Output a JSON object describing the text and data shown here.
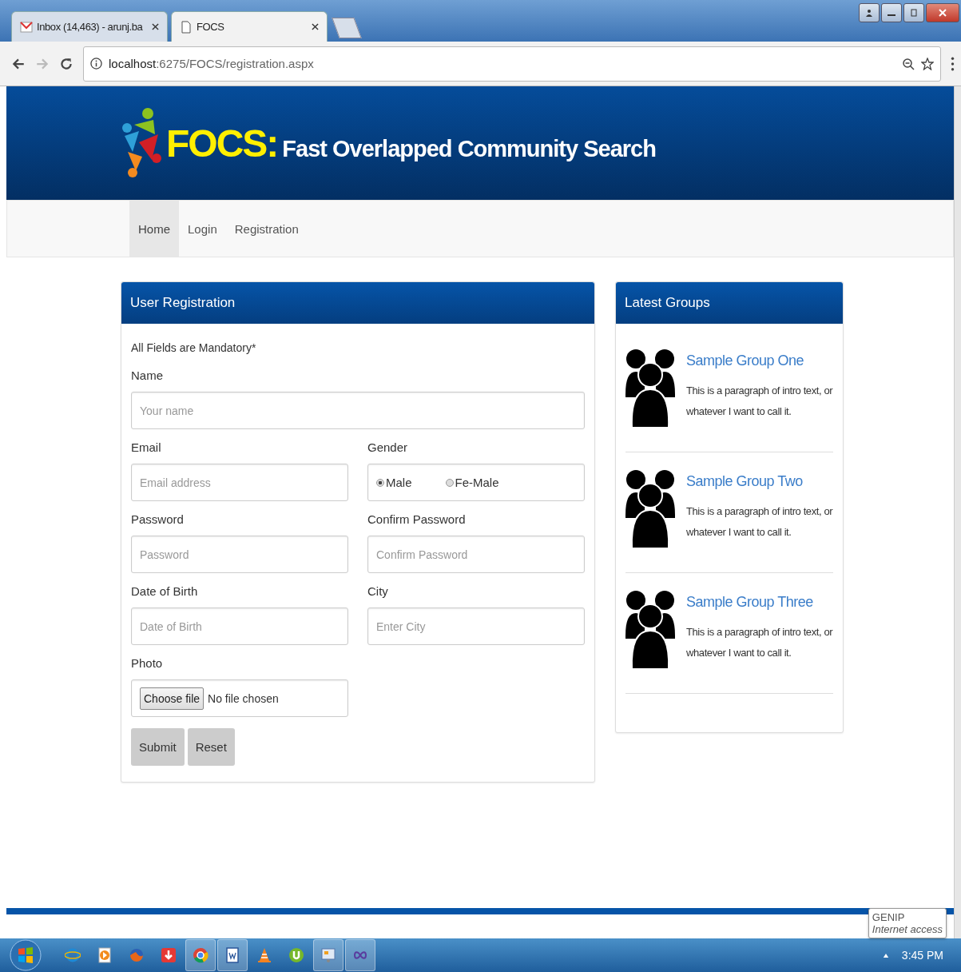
{
  "browser": {
    "tabs": [
      {
        "title": "Inbox (14,463) - arunj.ba",
        "selected": false
      },
      {
        "title": "FOCS",
        "selected": true
      }
    ],
    "url_host": "localhost",
    "url_path": ":6275/FOCS/registration.aspx"
  },
  "header": {
    "brand": "FOCS:",
    "tagline": "Fast Overlapped Community Search"
  },
  "nav": [
    {
      "label": "Home",
      "selected": true
    },
    {
      "label": "Login",
      "selected": false
    },
    {
      "label": "Registration",
      "selected": false
    }
  ],
  "registration": {
    "title": "User Registration",
    "note": "All Fields are Mandatory*",
    "rows": [
      [
        {
          "kind": "text",
          "label": "Name",
          "placeholder": "Your name"
        }
      ],
      [
        {
          "kind": "text",
          "label": "Email",
          "placeholder": "Email address"
        },
        {
          "kind": "radio",
          "label": "Gender",
          "options": [
            {
              "label": "Male",
              "selected": true
            },
            {
              "label": "Fe-Male",
              "selected": false
            }
          ]
        }
      ],
      [
        {
          "kind": "text",
          "label": "Password",
          "placeholder": "Password"
        },
        {
          "kind": "text",
          "label": "Confirm Password",
          "placeholder": "Confirm Password"
        }
      ],
      [
        {
          "kind": "text",
          "label": "Date of Birth",
          "placeholder": "Date of Birth"
        },
        {
          "kind": "text",
          "label": "City",
          "placeholder": "Enter City"
        }
      ],
      [
        {
          "kind": "file",
          "label": "Photo",
          "button": "Choose file",
          "status": "No file chosen"
        }
      ]
    ],
    "buttons": [
      "Submit",
      "Reset"
    ]
  },
  "groups": {
    "title": "Latest Groups",
    "items": [
      {
        "name": "Sample Group One",
        "text": "This is a paragraph of intro text, or whatever I want to call it."
      },
      {
        "name": "Sample Group Two",
        "text": "This is a paragraph of intro text, or whatever I want to call it."
      },
      {
        "name": "Sample Group Three",
        "text": "This is a paragraph of intro text, or whatever I want to call it."
      }
    ]
  },
  "tooltip": {
    "title": "GENIP",
    "text": "Internet access"
  },
  "taskbar": {
    "clock": "3:45 PM"
  }
}
